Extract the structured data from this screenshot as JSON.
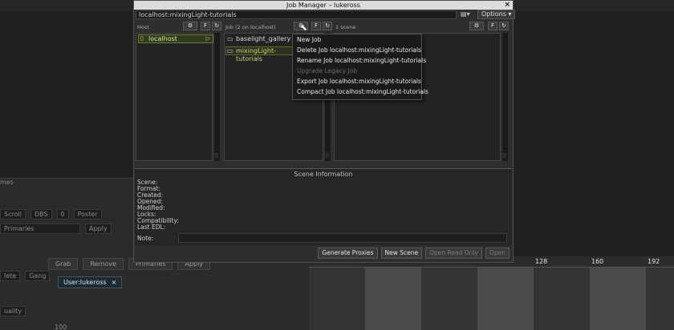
{
  "background": {
    "left_partial_label": "mes",
    "row1": {
      "scroll": "Scroll",
      "dbs": "DBS",
      "dbs_value": "0",
      "poster": "Poster"
    },
    "row2": {
      "primaries": "Primaries",
      "apply": "Apply"
    },
    "lower_toolbar": [
      "Grab",
      "Remove",
      "Primaries",
      "Apply"
    ],
    "lower_left": {
      "delete_partial": "lete",
      "gang": "Gang",
      "quality_partial": "uality"
    },
    "user_tab": "User:lukeross",
    "user_tab_close": "×",
    "bottom_value": "100",
    "timeline_ticks": [
      "128",
      "160",
      "192"
    ],
    "colors": {
      "band_light": "#4a4a4a",
      "band_dark": "#333333"
    }
  },
  "window": {
    "title": "Job Manager  –  lukeross",
    "close": "×",
    "address": "localhost:mixingLight-tutorials",
    "options_label": "Options",
    "host_label": "Host",
    "job_label": "Job (2 on localhost)",
    "scene_label": "1 scene",
    "hosts": [
      {
        "label": "localhost"
      }
    ],
    "jobs": [
      {
        "label": "baselight_gallery",
        "selected": false
      },
      {
        "label": "mixingLight-tutorials",
        "selected": true
      }
    ],
    "context_menu": [
      {
        "label": "New Job",
        "enabled": true
      },
      {
        "label": "Delete Job localhost:mixingLight-tutorials",
        "enabled": true
      },
      {
        "label": "Rename Job localhost:mixingLight-tutorials",
        "enabled": true
      },
      {
        "label": "Upgrade Legacy Job",
        "enabled": false
      },
      {
        "label": "Export Job localhost:mixingLight-tutorials",
        "enabled": true
      },
      {
        "label": "Compact Job localhost:mixingLight-tutorials",
        "enabled": true
      }
    ],
    "scene_info": {
      "title": "Scene Information",
      "fields": [
        "Scene:",
        "Format:",
        "Created:",
        "Opened:",
        "Modified:",
        "Locks:",
        "Compatibility:",
        "Last EDL:"
      ],
      "note_label": "Note:"
    },
    "buttons": {
      "generate_proxies": "Generate Proxies",
      "new_scene": "New Scene",
      "open_read_only": "Open Read Only",
      "open": "Open"
    },
    "icons": {
      "gear": "⚙",
      "f_button": "F",
      "refresh": "↻",
      "chevron": "▾",
      "computer": "▯",
      "play": "▷",
      "folder": "▭",
      "grip": "||"
    }
  }
}
